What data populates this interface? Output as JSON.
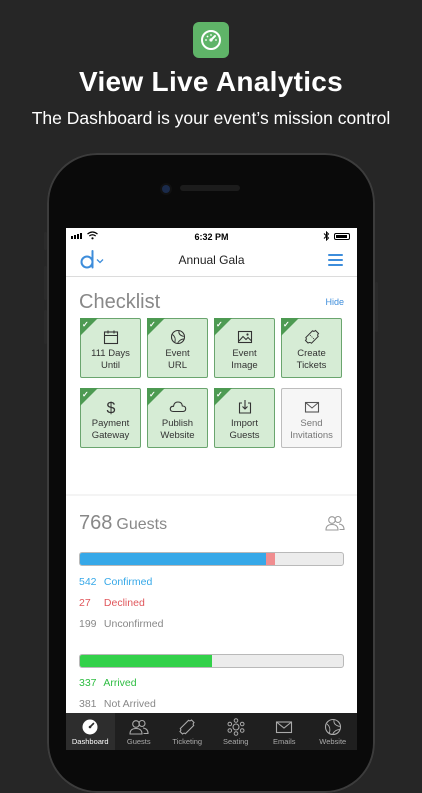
{
  "promo": {
    "title": "View Live Analytics",
    "subtitle": "The Dashboard is your event’s mission control",
    "icon": "speedometer-icon"
  },
  "status_bar": {
    "time": "6:32 PM"
  },
  "nav": {
    "title": "Annual Gala",
    "logo": "d-logo-icon",
    "menu_icon": "hamburger-menu-icon"
  },
  "checklist": {
    "heading": "Checklist",
    "hide_label": "Hide",
    "items": [
      {
        "line1": "111 Days",
        "line2": "Until",
        "icon": "calendar-icon",
        "done": true
      },
      {
        "line1": "Event",
        "line2": "URL",
        "icon": "globe-icon",
        "done": true
      },
      {
        "line1": "Event",
        "line2": "Image",
        "icon": "image-icon",
        "done": true
      },
      {
        "line1": "Create",
        "line2": "Tickets",
        "icon": "ticket-icon",
        "done": true
      },
      {
        "line1": "Payment",
        "line2": "Gateway",
        "icon": "dollar-icon",
        "done": true
      },
      {
        "line1": "Publish",
        "line2": "Website",
        "icon": "cloud-icon",
        "done": true
      },
      {
        "line1": "Import",
        "line2": "Guests",
        "icon": "import-icon",
        "done": true
      },
      {
        "line1": "Send",
        "line2": "Invitations",
        "icon": "envelope-icon",
        "done": false
      }
    ]
  },
  "guests": {
    "total": "768",
    "label": "Guests",
    "rsvp_bar": {
      "confirmed_fraction": 0.7057,
      "declined_fraction": 0.0352
    },
    "confirmed": {
      "count": "542",
      "label": "Confirmed"
    },
    "declined": {
      "count": "27",
      "label": "Declined"
    },
    "unconfirmed": {
      "count": "199",
      "label": "Unconfirmed"
    },
    "arrival_bar": {
      "arrived_fraction": 0.5
    },
    "arrived": {
      "count": "337",
      "label": "Arrived"
    },
    "not_arrived": {
      "count": "381",
      "label": "Not Arrived"
    }
  },
  "colors": {
    "accent_blue": "#3d8ddb",
    "confirmed": "#36a8e8",
    "declined": "#f08d8f",
    "arrived": "#33d14a",
    "tile_done_bg": "#d6ecd5",
    "tile_done_border": "#4d9a52"
  },
  "tabs": [
    {
      "label": "Dashboard",
      "icon": "speedometer-icon",
      "active": true
    },
    {
      "label": "Guests",
      "icon": "people-icon",
      "active": false
    },
    {
      "label": "Ticketing",
      "icon": "ticket-icon",
      "active": false
    },
    {
      "label": "Seating",
      "icon": "seating-icon",
      "active": false
    },
    {
      "label": "Emails",
      "icon": "envelope-icon",
      "active": false
    },
    {
      "label": "Website",
      "icon": "globe-icon",
      "active": false
    }
  ]
}
